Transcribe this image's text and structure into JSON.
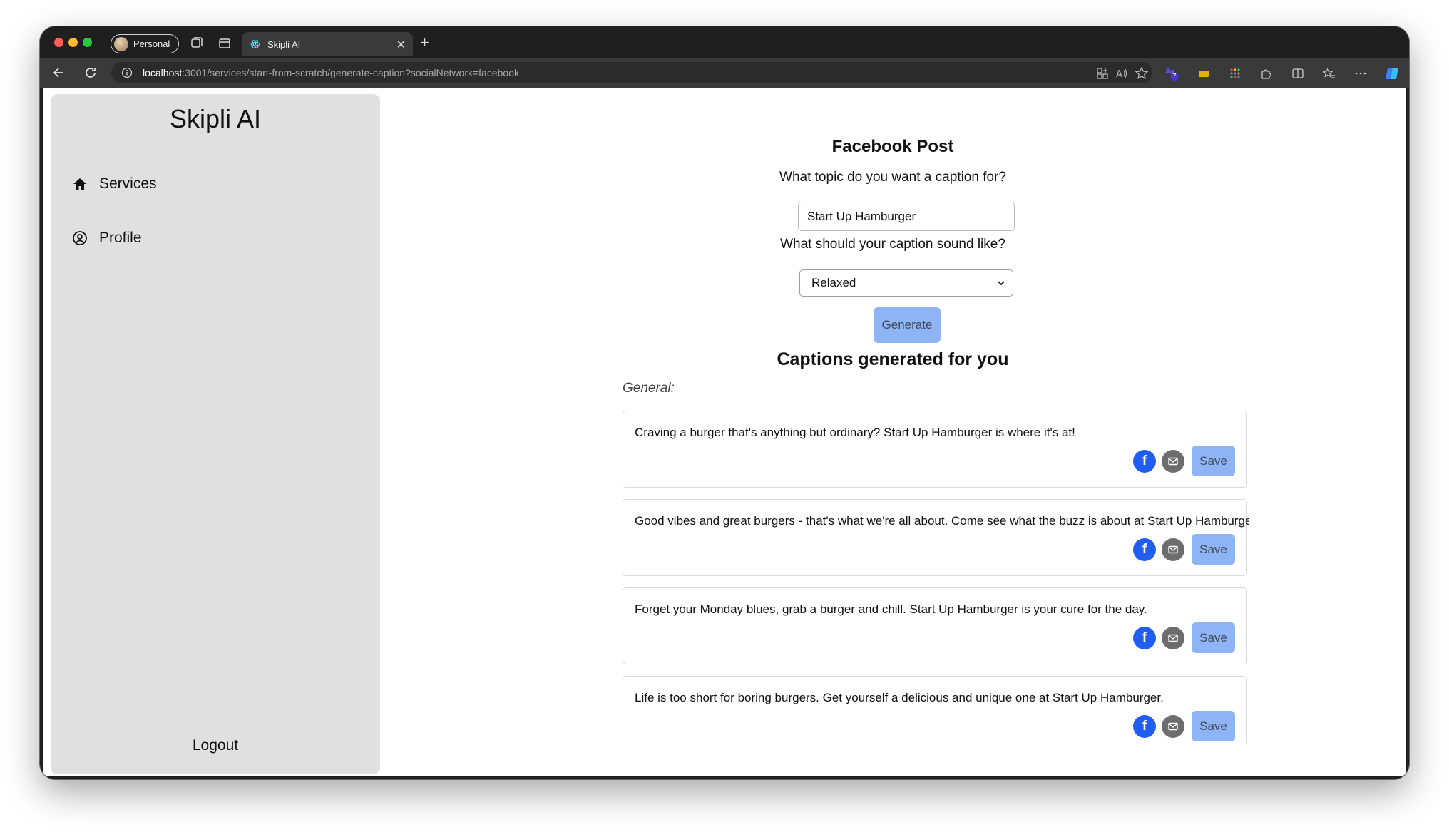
{
  "browser": {
    "profile_label": "Personal",
    "tab_title": "Skipli AI",
    "url_host": "localhost",
    "url_path": ":3001/services/start-from-scratch/generate-caption?socialNetwork=facebook",
    "extension_badge": "7"
  },
  "sidebar": {
    "brand": "Skipli AI",
    "items": [
      {
        "label": "Services",
        "icon": "home-icon"
      },
      {
        "label": "Profile",
        "icon": "user-circle-icon"
      }
    ],
    "logout_label": "Logout"
  },
  "form": {
    "title": "Facebook Post",
    "topic_question": "What topic do you want a caption for?",
    "topic_value": "Start Up Hamburger",
    "tone_question": "What should your caption sound like?",
    "tone_value": "Relaxed",
    "generate_label": "Generate"
  },
  "captions": {
    "title": "Captions generated for you",
    "category": "General:",
    "save_label": "Save",
    "items": [
      {
        "text": "Craving a burger that's anything but ordinary? Start Up Hamburger is where it's at!"
      },
      {
        "text": "Good vibes and great burgers - that's what we're all about. Come see what the buzz is about at Start Up Hamburger."
      },
      {
        "text": "Forget your Monday blues, grab a burger and chill. Start Up Hamburger is your cure for the day."
      },
      {
        "text": "Life is too short for boring burgers. Get yourself a delicious and unique one at Start Up Hamburger."
      }
    ]
  },
  "colors": {
    "accent_button": "#8fb4f5",
    "facebook_blue": "#1f5ef0",
    "sidebar_bg": "#e0e0e0"
  }
}
